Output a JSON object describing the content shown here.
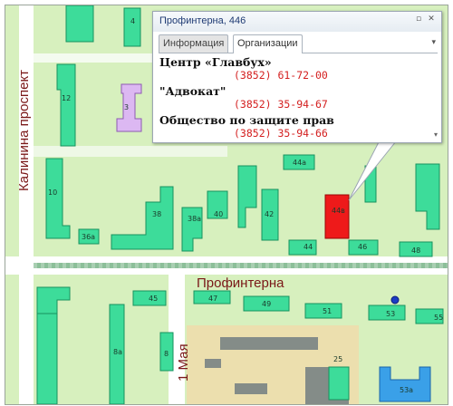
{
  "map": {
    "colors": {
      "land": "#d7f0be",
      "building": "#3ddc9a",
      "building_dark": "#17925e",
      "highlight": "#ee1a1a",
      "highlight_dark": "#9a0606",
      "admin": "#dcb8f2",
      "admin_dark": "#8e5ab2",
      "school": "#3aa0e8",
      "industrial_zone": "#ecdfae",
      "industrial_bldg": "#848c88",
      "road": "#ffffff",
      "rail": "#a9cfb2",
      "street_label": "#7a1818"
    },
    "streets": {
      "main": "Профинтерна",
      "left": "Калинина проспект",
      "bottom": "1 Мая"
    },
    "labels": {
      "b4": "4",
      "b12": "12",
      "b3": "3",
      "b10": "10",
      "b36a": "36а",
      "b38": "38",
      "b38a": "38а",
      "b40": "40",
      "b42": "42",
      "b44a": "44а",
      "b44v": "44в",
      "b44": "44",
      "b46": "46",
      "b48": "48",
      "b45": "45",
      "b47": "47",
      "b49": "49",
      "b51": "51",
      "b53": "53",
      "b55": "55",
      "b8": "8",
      "b8a": "8а",
      "b25": "25",
      "b53a": "53а"
    }
  },
  "info_window": {
    "title": "Профинтерна, 446",
    "tabs": [
      {
        "label": "Информация",
        "active": false
      },
      {
        "label": "Организации",
        "active": true
      }
    ],
    "organizations": [
      {
        "name": "Центр «Главбух»",
        "phone": "(3852) 61-72-00"
      },
      {
        "name": "\"Адвокат\"",
        "phone": "(3852) 35-94-67"
      },
      {
        "name": "Общество по защите прав",
        "phone": "(3852) 35-94-66"
      }
    ],
    "icons": {
      "minimize": "minimize-icon",
      "close": "close-icon",
      "dropdown": "chevron-down-icon"
    }
  }
}
